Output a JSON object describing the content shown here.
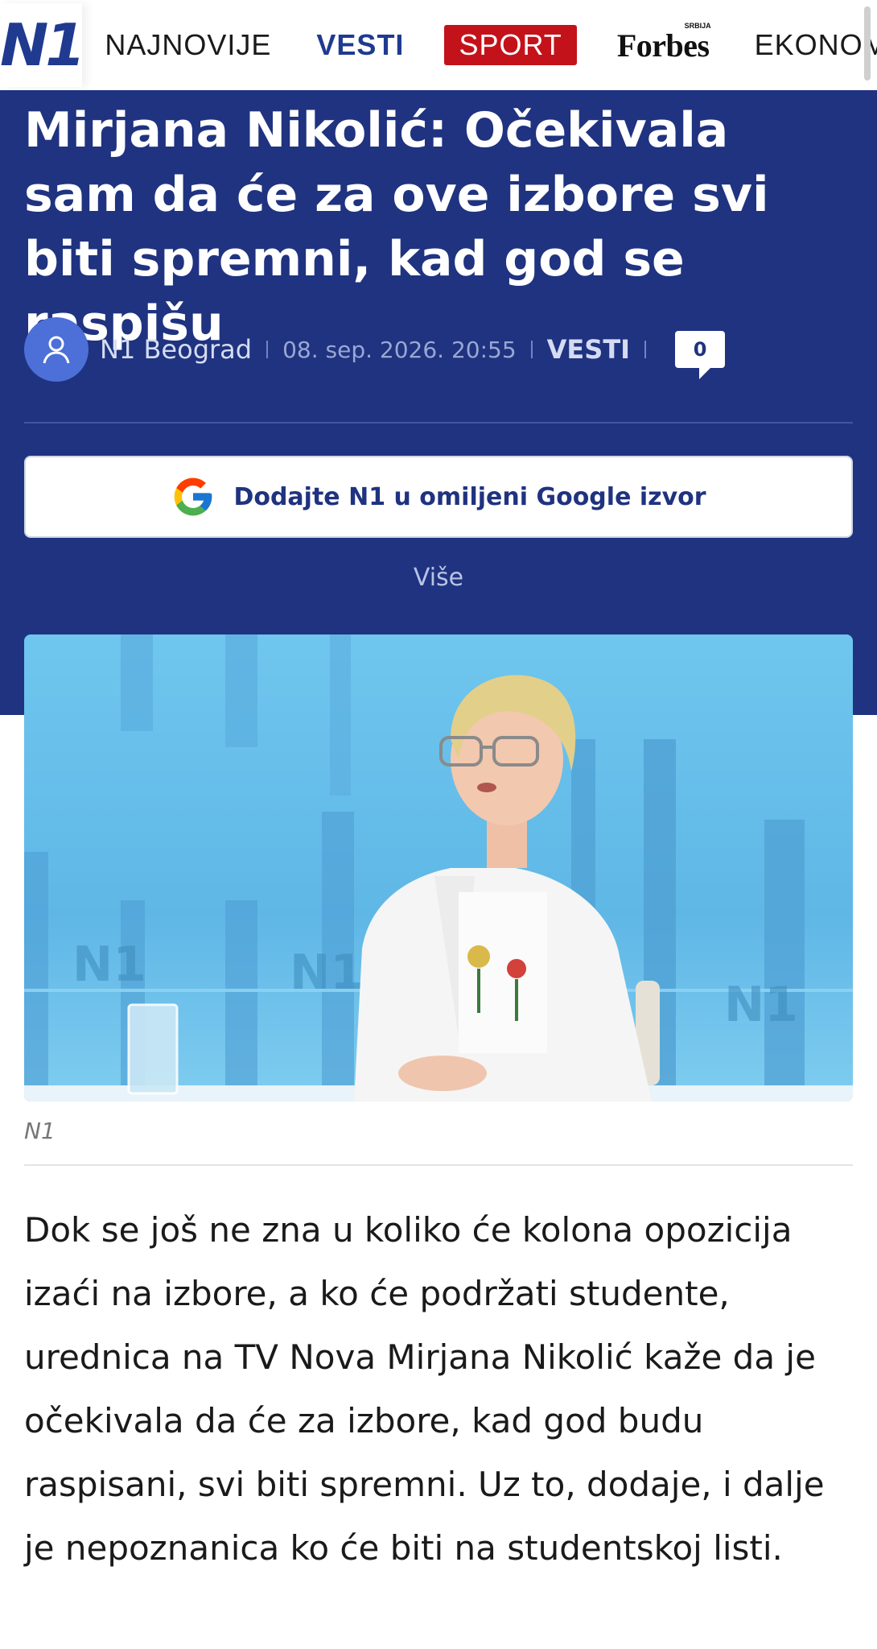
{
  "nav": {
    "logo": "N1",
    "items": [
      "NAJNOVIJE",
      "VESTI",
      "SPORT",
      "Forbes",
      "EKONOMIJA"
    ],
    "forbes_sup": "SRBIJA"
  },
  "article": {
    "title": "Mirjana Nikolić: Očekivala sam da će za ove izbore svi biti spremni, kad god se raspišu",
    "author": "N1 Beograd",
    "date": "08. sep. 2026. 20:55",
    "category": "VESTI",
    "comments": "0",
    "google_button": "Dodajte N1 u omiljeni Google izvor",
    "more_link": "Više",
    "photo_watermark": "N1",
    "photo_caption": "N1",
    "lead": "Dok se još ne zna u koliko će kolona opozicija izaći na izbore, a ko će podržati studente, urednica na TV Nova Mirjana Nikolić kaže da je očekivala da će za izbore, kad god budu raspisani, svi biti spremni. Uz to, dodaje, i dalje je nepoznanica ko će biti na studentskoj listi."
  },
  "colors": {
    "brand_blue": "#1f3380",
    "sport_red": "#c4121a",
    "avatar_blue": "#4d6fd8"
  }
}
